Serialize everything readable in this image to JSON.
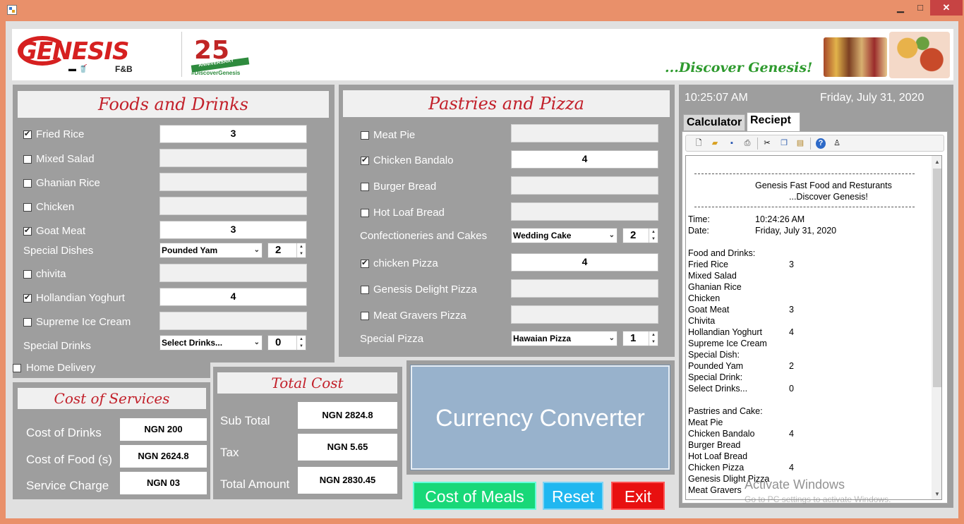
{
  "window": {
    "min_glyph": "▁",
    "max_glyph": "□",
    "close_glyph": "✕"
  },
  "header": {
    "logo_text": "GENESIS",
    "logo_sub": "F&B",
    "anniversary_number": "25",
    "anniversary_word": "ANNIVERSARY",
    "anniversary_tag": "#DiscoverGenesis",
    "tagline": "...Discover Genesis!"
  },
  "foods": {
    "title": "Foods and Drinks",
    "items": [
      {
        "label": "Fried Rice",
        "checked": true,
        "qty": "3"
      },
      {
        "label": "Mixed Salad",
        "checked": false,
        "qty": ""
      },
      {
        "label": "Ghanian Rice",
        "checked": false,
        "qty": ""
      },
      {
        "label": "Chicken",
        "checked": false,
        "qty": ""
      },
      {
        "label": "Goat Meat",
        "checked": true,
        "qty": "3"
      }
    ],
    "special_dishes_label": "Special Dishes",
    "special_dishes_value": "Pounded Yam",
    "special_dishes_qty": "2",
    "items2": [
      {
        "label": "chivita",
        "checked": false,
        "qty": ""
      },
      {
        "label": "Hollandian Yoghurt",
        "checked": true,
        "qty": "4"
      },
      {
        "label": "Supreme Ice Cream",
        "checked": false,
        "qty": ""
      }
    ],
    "special_drinks_label": "Special Drinks",
    "special_drinks_value": "Select Drinks...",
    "special_drinks_qty": "0",
    "home_delivery_label": "Home Delivery"
  },
  "pastries": {
    "title": "Pastries and Pizza",
    "items": [
      {
        "label": "Meat Pie",
        "checked": false,
        "qty": ""
      },
      {
        "label": "Chicken Bandalo",
        "checked": true,
        "qty": "4"
      },
      {
        "label": "Burger Bread",
        "checked": false,
        "qty": ""
      },
      {
        "label": "Hot Loaf Bread",
        "checked": false,
        "qty": ""
      }
    ],
    "cakes_label": "Confectioneries and Cakes",
    "cakes_value": "Wedding Cake",
    "cakes_qty": "2",
    "items2": [
      {
        "label": "chicken Pizza",
        "checked": true,
        "qty": "4"
      },
      {
        "label": "Genesis Delight Pizza",
        "checked": false,
        "qty": ""
      },
      {
        "label": "Meat Gravers Pizza",
        "checked": false,
        "qty": ""
      }
    ],
    "special_pizza_label": "Special Pizza",
    "special_pizza_value": "Hawaian Pizza",
    "special_pizza_qty": "1"
  },
  "services": {
    "title": "Cost of Services",
    "rows": [
      {
        "label": "Cost of Drinks",
        "value": "NGN 200"
      },
      {
        "label": "Cost of Food (s)",
        "value": "NGN 2624.8"
      },
      {
        "label": "Service Charge",
        "value": "NGN 03"
      }
    ]
  },
  "total": {
    "title": "Total Cost",
    "rows": [
      {
        "label": "Sub Total",
        "value": "NGN 2824.8"
      },
      {
        "label": "Tax",
        "value": "NGN 5.65"
      },
      {
        "label": "Total Amount",
        "value": "NGN 2830.45"
      }
    ]
  },
  "currency_converter": "Currency Converter",
  "buttons": {
    "meals": "Cost of Meals",
    "reset": "Reset",
    "exit": "Exit"
  },
  "clock": {
    "time": "10:25:07 AM",
    "date": "Friday, July 31, 2020"
  },
  "tabs": {
    "calculator": "Calculator",
    "receipt": "Reciept"
  },
  "receipt": {
    "dashes": "---------------------------------------------------------------------------",
    "company": "Genesis Fast Food and Resturants",
    "tagline": "...Discover Genesis!",
    "time_label": "Time:",
    "time_value": "10:24:26 AM",
    "date_label": "Date:",
    "date_value": "Friday, July 31, 2020",
    "food_header": "Food and Drinks:",
    "food_lines": [
      {
        "name": "Fried Rice",
        "qty": "3"
      },
      {
        "name": "Mixed Salad",
        "qty": ""
      },
      {
        "name": "Ghanian Rice",
        "qty": ""
      },
      {
        "name": "Chicken",
        "qty": ""
      },
      {
        "name": "Goat Meat",
        "qty": "3"
      },
      {
        "name": "Chivita",
        "qty": ""
      },
      {
        "name": "Hollandian Yoghurt",
        "qty": "4"
      },
      {
        "name": "Supreme Ice Cream",
        "qty": ""
      },
      {
        "name": "Special Dish:",
        "qty": ""
      },
      {
        "name": "Pounded Yam",
        "qty": "2"
      },
      {
        "name": "Special Drink:",
        "qty": ""
      },
      {
        "name": "Select Drinks...",
        "qty": "0"
      }
    ],
    "pastry_header": "Pastries and Cake:",
    "pastry_lines": [
      {
        "name": "Meat Pie",
        "qty": ""
      },
      {
        "name": "Chicken Bandalo",
        "qty": "4"
      },
      {
        "name": "Burger Bread",
        "qty": ""
      },
      {
        "name": "Hot Loaf Bread",
        "qty": ""
      },
      {
        "name": "Chicken Pizza",
        "qty": "4"
      },
      {
        "name": "Genesis Dlight Pizza",
        "qty": ""
      },
      {
        "name": "Meat Gravers",
        "qty": ""
      }
    ]
  },
  "watermark": {
    "line1": "Activate Windows",
    "line2": "Go to PC settings to activate Windows."
  },
  "colors": {
    "panel": "#9e9e9e",
    "title_red": "#c2202a",
    "meals_green": "#18d878",
    "reset_blue": "#20b7f0",
    "exit_red": "#e81010",
    "converter_blue": "#98b2cc"
  }
}
